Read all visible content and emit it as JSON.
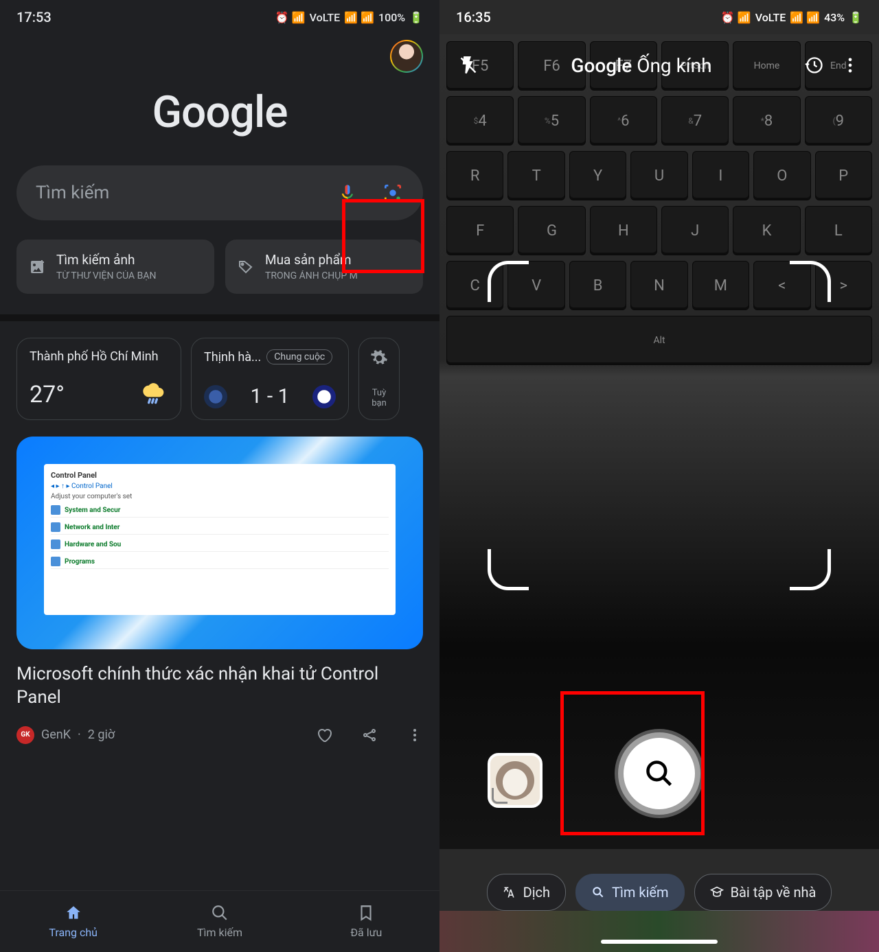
{
  "left": {
    "status": {
      "time": "17:53",
      "battery": "100%",
      "net": "VoLTE"
    },
    "logo": "Google",
    "search": {
      "placeholder": "Tìm kiếm"
    },
    "chips": [
      {
        "title": "Tìm kiếm ảnh",
        "sub": "TỪ THƯ VIỆN CỦA BẠN"
      },
      {
        "title": "Mua sản phẩm",
        "sub": "TRONG ẢNH CHỤP M"
      }
    ],
    "weather": {
      "city": "Thành phố Hồ Chí Minh",
      "temp": "27°"
    },
    "sport": {
      "title": "Thịnh hà...",
      "badge": "Chung cuộc",
      "score": "1 - 1"
    },
    "settings_sub": "Tuỳ\nbạn",
    "article": {
      "title": "Microsoft chính thức xác nhận khai tử Control Panel",
      "source": "GenK",
      "age": "2 giờ",
      "cp_title": "Control Panel",
      "cp_sub": "Adjust your computer's set",
      "cp_items": [
        "System and Secur",
        "Network and Inter",
        "Hardware and Sou",
        "Programs"
      ]
    },
    "nav": [
      {
        "label": "Trang chủ",
        "active": true
      },
      {
        "label": "Tìm kiếm",
        "active": false
      },
      {
        "label": "Đã lưu",
        "active": false
      }
    ]
  },
  "right": {
    "status": {
      "time": "16:35",
      "battery": "43%",
      "net": "VoLTE"
    },
    "header": {
      "title_a": "Google",
      "title_b": " Ống kính"
    },
    "keyboard": {
      "row0": [
        "F5",
        "F6",
        "F7",
        "PrtScn",
        "Home",
        "End"
      ],
      "row1": [
        "$",
        "%",
        "^",
        "&",
        "*",
        "("
      ],
      "row1b": [
        "4",
        "5",
        "6",
        "7",
        "8",
        "9"
      ],
      "row2": [
        "R",
        "T",
        "Y",
        "U",
        "I",
        "O",
        "P"
      ],
      "row3": [
        "F",
        "G",
        "H",
        "J",
        "K",
        "L"
      ],
      "row4": [
        "C",
        "V",
        "B",
        "N",
        "M",
        "<",
        ">"
      ],
      "row5": [
        "Alt"
      ]
    },
    "modes": [
      {
        "label": "Dịch",
        "active": false,
        "icon": "translate"
      },
      {
        "label": "Tìm kiếm",
        "active": true,
        "icon": "search"
      },
      {
        "label": "Bài tập về nhà",
        "active": false,
        "icon": "homework"
      }
    ]
  }
}
